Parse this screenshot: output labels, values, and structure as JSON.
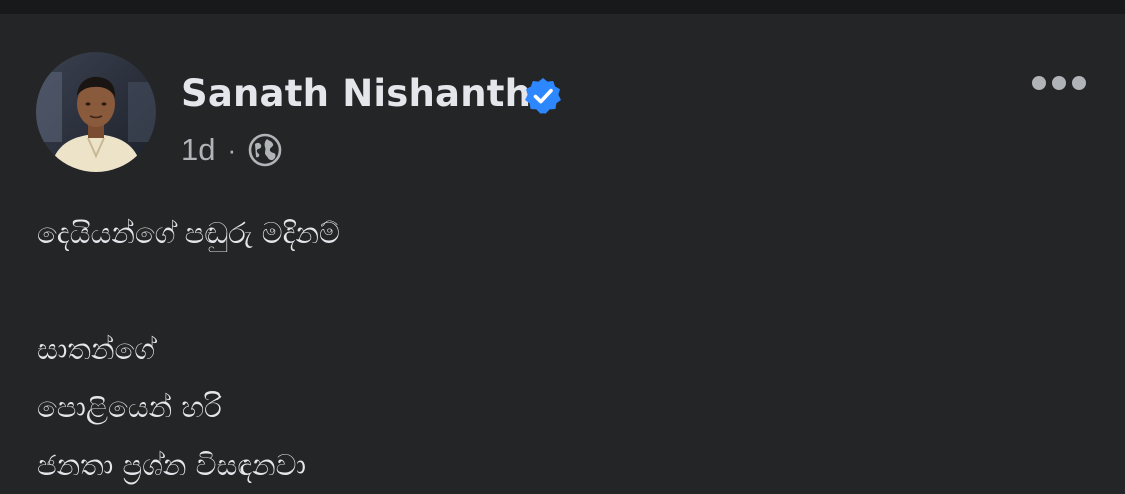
{
  "post": {
    "author_name": "Sanath Nishantha",
    "verified_icon": "verified-badge-icon",
    "timestamp": "1d",
    "separator": "·",
    "audience_icon": "globe-icon",
    "more_icon": "more-options-icon",
    "lines": [
      "දෙයියන්ගේ පඬුරු මදිනම්",
      "",
      "සාතන්ගේ",
      "පොළියෙන් හරි",
      "ජනතා ප්‍රශ්න විසඳනවා"
    ]
  },
  "colors": {
    "background": "#242526",
    "text_primary": "#e4e6eb",
    "text_secondary": "#b0b3b8",
    "verified_blue": "#2d88ff"
  }
}
